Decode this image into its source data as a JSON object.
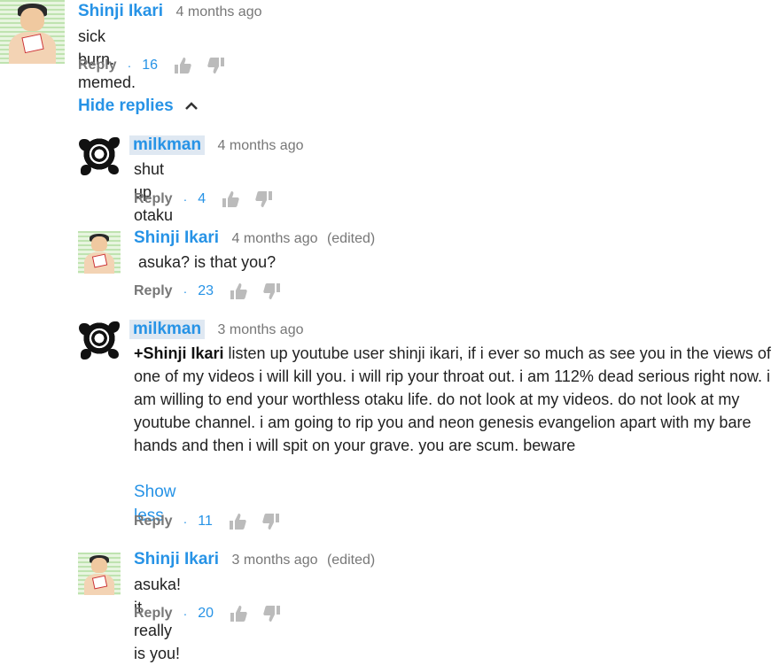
{
  "comments": [
    {
      "author": "Shinji Ikari",
      "time": "4 months ago",
      "edited": "",
      "text": "sick burn. memed.",
      "reply_label": "Reply",
      "likes": "16"
    },
    {
      "author": "milkman",
      "time": "4 months ago",
      "edited": "",
      "text": "shut up otaku",
      "reply_label": "Reply",
      "likes": "4"
    },
    {
      "author": "Shinji Ikari",
      "time": "4 months ago",
      "edited": "(edited)",
      "text": " asuka? is that you?",
      "reply_label": "Reply",
      "likes": "23"
    },
    {
      "author": "milkman",
      "time": "3 months ago",
      "edited": "",
      "mention": "+Shinji Ikari",
      "text": " listen up youtube user shinji ikari, if i ever so much as see you in the views of one of my videos i will kill you. i will rip your throat out. i am 112% dead serious right now. i am willing to end your worthless otaku life. do not look at my videos. do not look at my youtube channel. i am going to rip you and neon genesis evangelion apart with my bare hands and then i will spit on your grave. you are scum. beware",
      "show_less": "Show less",
      "reply_label": "Reply",
      "likes": "11"
    },
    {
      "author": "Shinji Ikari",
      "time": "3 months ago",
      "edited": "(edited)",
      "text": "asuka! it really is you!",
      "reply_label": "Reply",
      "likes": "20"
    }
  ],
  "hide_replies_label": "Hide replies",
  "icons": {
    "like": "thumbs-up-icon",
    "dislike": "thumbs-down-icon",
    "collapse": "chevron-up-icon"
  },
  "colors": {
    "link": "#2793e6",
    "meta": "#777777",
    "text": "#222222",
    "highlight": "#dfe8f2"
  }
}
